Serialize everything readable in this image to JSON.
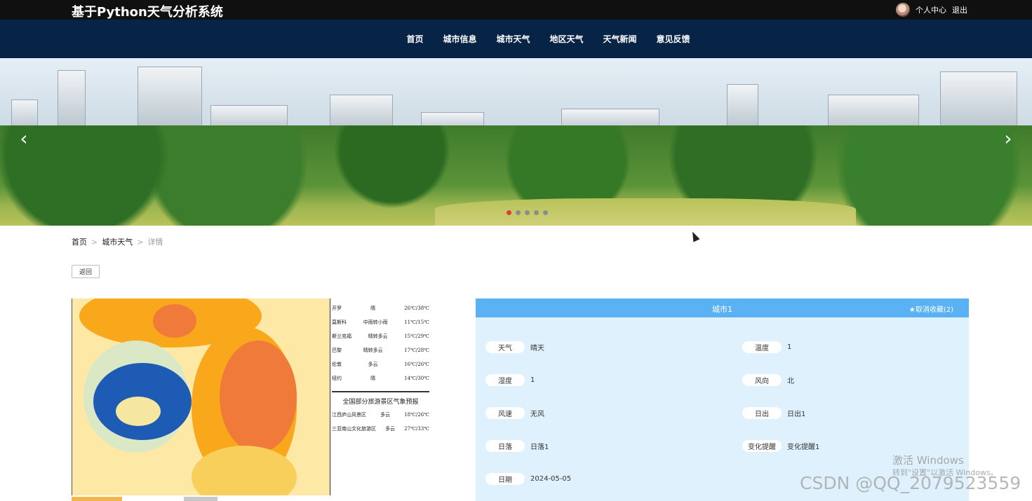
{
  "header": {
    "title": "基于Python天气分析系统",
    "user_center": "个人中心",
    "logout": "退出"
  },
  "nav": {
    "items": [
      "首页",
      "城市信息",
      "城市天气",
      "地区天气",
      "天气新闻",
      "意见反馈"
    ]
  },
  "banner": {
    "prev_icon": "chevron-left-icon",
    "next_icon": "chevron-right-icon",
    "slides": 5,
    "active_slide": 1
  },
  "breadcrumb": {
    "home": "首页",
    "section": "城市天气",
    "current": "详情",
    "separator": ">"
  },
  "back_button": "返回",
  "map_table": {
    "rows": [
      {
        "city": "开罗",
        "weather": "晴",
        "temp": "26℃/38℃"
      },
      {
        "city": "莫斯科",
        "weather": "中雨转小雨",
        "temp": "11℃/15℃"
      },
      {
        "city": "斯兰克福",
        "weather": "晴转多云",
        "temp": "15℃/29℃"
      },
      {
        "city": "巴黎",
        "weather": "晴转多云",
        "temp": "17℃/28℃"
      },
      {
        "city": "伦敦",
        "weather": "多云",
        "temp": "16℃/26℃"
      },
      {
        "city": "纽约",
        "weather": "晴",
        "temp": "14℃/30℃"
      }
    ],
    "section_title": "全国部分旅游景区气象预报",
    "scenic_rows": [
      {
        "name": "江西庐山风景区",
        "weather": "多云",
        "temp": "18℃/26℃"
      },
      {
        "name": "三亚南山文化旅游区",
        "weather": "多云",
        "temp": "27℃/33℃"
      }
    ]
  },
  "detail": {
    "city": "城市1",
    "favorite": "★取消收藏(2)",
    "fields": [
      {
        "label": "天气",
        "value": "晴天"
      },
      {
        "label": "温度",
        "value": "1"
      },
      {
        "label": "湿度",
        "value": "1"
      },
      {
        "label": "风向",
        "value": "北"
      },
      {
        "label": "风速",
        "value": "无风"
      },
      {
        "label": "日出",
        "value": "日出1"
      },
      {
        "label": "日落",
        "value": "日落1"
      },
      {
        "label": "变化提醒",
        "value": "变化提醒1"
      },
      {
        "label": "日期",
        "value": "2024-05-05"
      }
    ]
  },
  "watermarks": {
    "windows_line1": "激活 Windows",
    "windows_line2": "转到\"设置\"以激活 Windows。",
    "csdn": "CSDN @QQ_2079523559"
  },
  "colors": {
    "topbar": "#101010",
    "navbar": "#072447",
    "panel_header": "#5ab2f5",
    "panel_body": "#dff1fd",
    "active_dot": "#e63b3b"
  }
}
